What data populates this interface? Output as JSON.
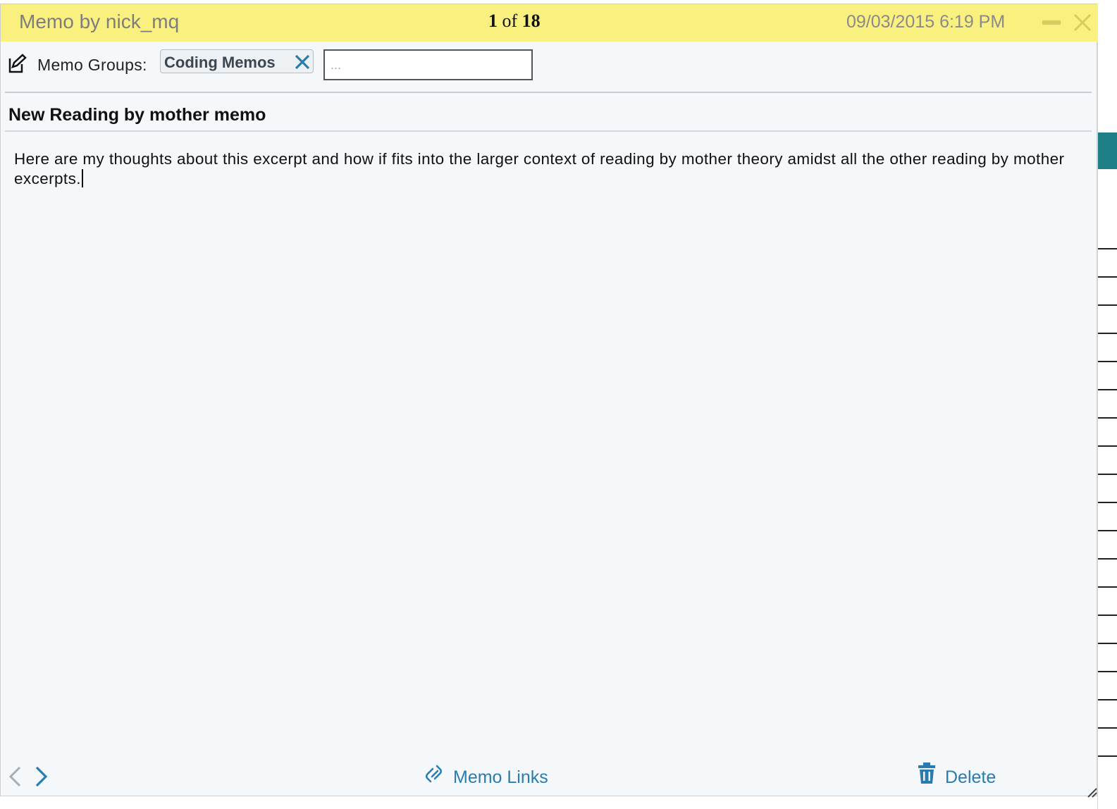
{
  "memo": {
    "title": "Memo by nick_mq",
    "counter": {
      "current": "1",
      "of_label": "of",
      "total": "18"
    },
    "timestamp": "09/03/2015 6:19 PM",
    "groups_label": "Memo Groups:",
    "groups": [
      {
        "label": "Coding Memos"
      }
    ],
    "group_input": {
      "placeholder": "...",
      "value": ""
    },
    "heading": "New Reading by mother memo",
    "body": "Here are my thoughts about this excerpt and how if fits into the larger context of reading by mother theory amidst all the other reading by mother excerpts.",
    "footer": {
      "links_label": "Memo Links",
      "delete_label": "Delete"
    }
  },
  "colors": {
    "titlebar_bg": "#faf07f",
    "accent_blue": "#2a7cb0",
    "dialog_bg": "#f5f8fa"
  },
  "icons": [
    "minimize-icon",
    "close-icon",
    "edit-memo-icon",
    "tag-remove-icon",
    "chevron-left-icon",
    "chevron-right-icon",
    "link-icon",
    "trash-icon"
  ]
}
